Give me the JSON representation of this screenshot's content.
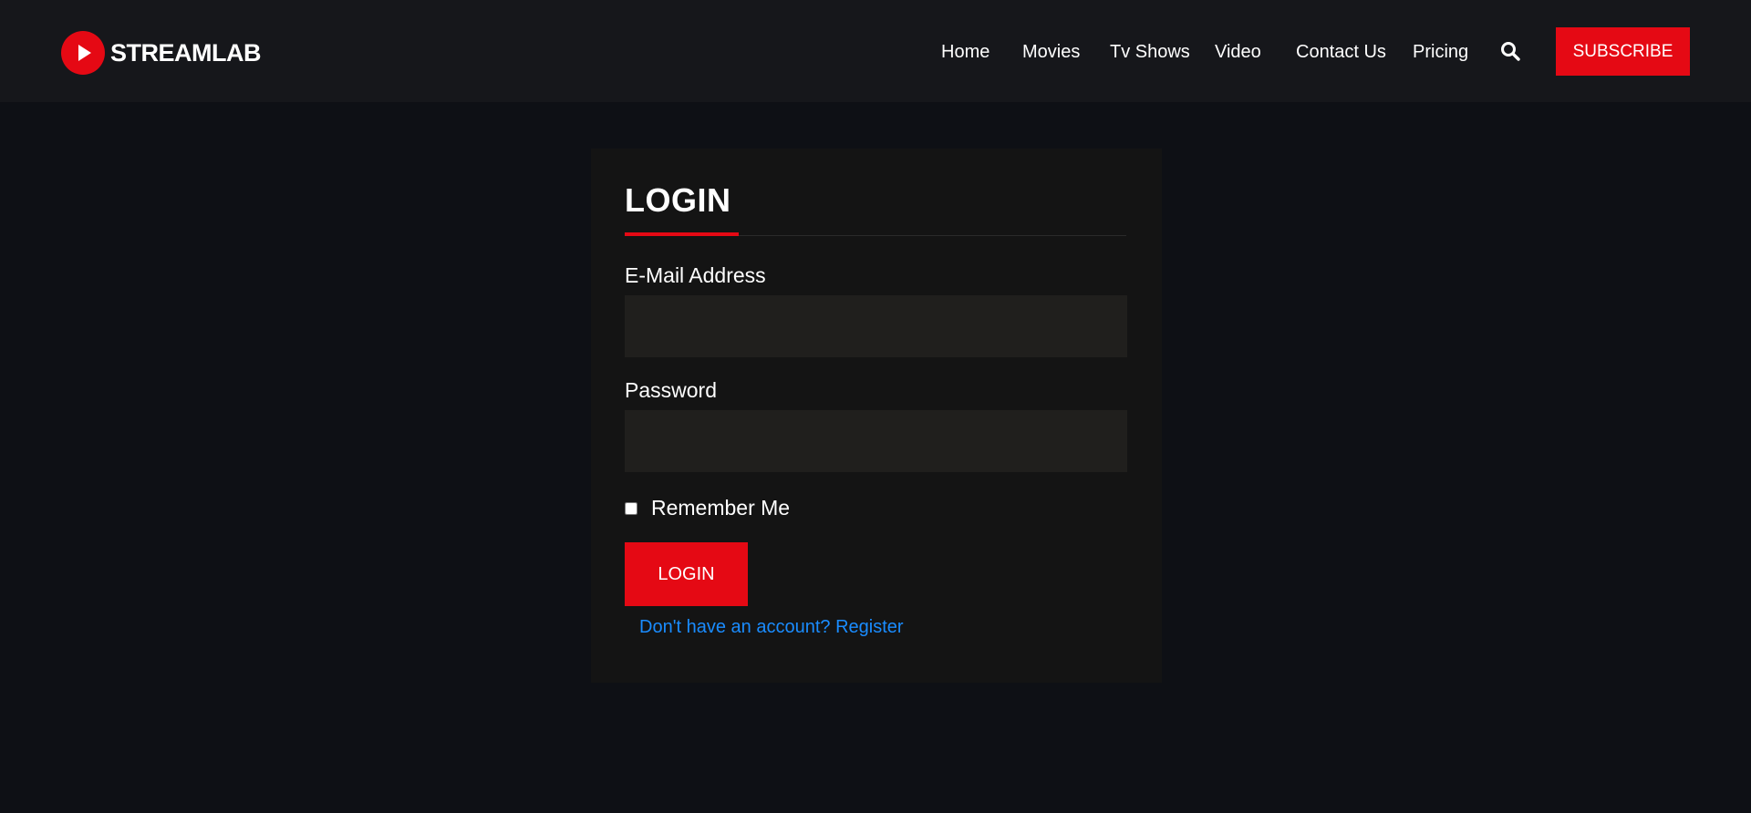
{
  "header": {
    "logo_text": "STREAMLAB",
    "nav": [
      {
        "label": "Home"
      },
      {
        "label": "Movies"
      },
      {
        "label": "Tv Shows"
      },
      {
        "label": "Video"
      },
      {
        "label": "Contact Us"
      },
      {
        "label": "Pricing"
      }
    ],
    "subscribe_label": "SUBSCRIBE"
  },
  "login": {
    "title": "LOGIN",
    "email_label": "E-Mail Address",
    "email_value": "",
    "password_label": "Password",
    "password_value": "",
    "remember_label": "Remember Me",
    "remember_checked": false,
    "submit_label": "LOGIN",
    "register_link": "Don't have an account? Register"
  },
  "colors": {
    "accent": "#e50914",
    "background": "#0e1015",
    "header_bg": "#16171b",
    "card_bg": "#141414",
    "input_bg": "#201f1d",
    "link": "#1a8cff"
  }
}
